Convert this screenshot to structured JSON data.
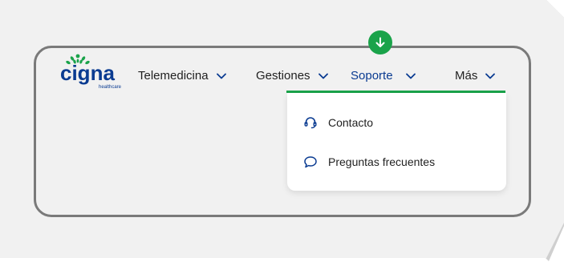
{
  "logo": {
    "brand": "cigna",
    "tagline": "healthcare",
    "brand_color": "#0a3b91",
    "leaf_color": "#1aa34a"
  },
  "nav": {
    "items": [
      {
        "label": "Telemedicina"
      },
      {
        "label": "Gestiones"
      },
      {
        "label": "Soporte",
        "active": true
      },
      {
        "label": "Más"
      }
    ]
  },
  "dropdown": {
    "items": [
      {
        "label": "Contacto",
        "icon": "headset-icon"
      },
      {
        "label": "Preguntas frecuentes",
        "icon": "chat-bubble-icon"
      }
    ]
  },
  "marker": {
    "icon": "arrow-down-icon",
    "color": "#1aa34a"
  },
  "colors": {
    "accent": "#1aa34a",
    "link": "#0a3b91",
    "frame": "#7a7a7a"
  }
}
